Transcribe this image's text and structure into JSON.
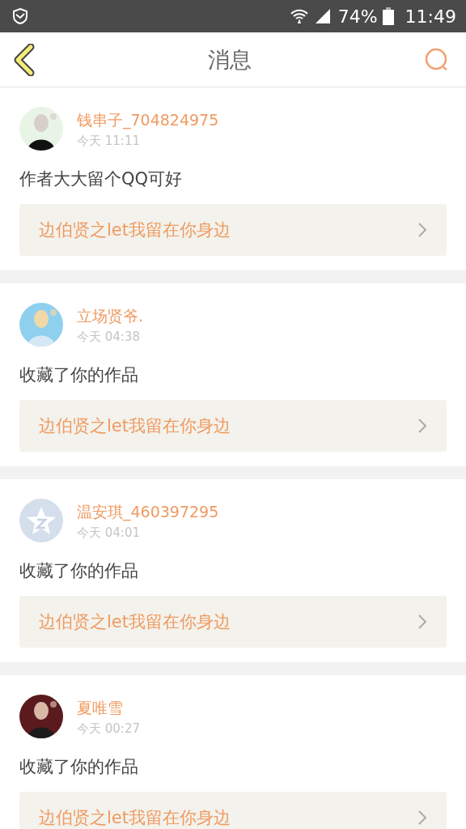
{
  "status_bar": {
    "battery": "74%",
    "time": "11:49"
  },
  "header": {
    "title": "消息"
  },
  "messages": [
    {
      "name": "钱串子_704824975",
      "time": "今天 11:11",
      "text": "作者大大留个QQ可好",
      "work": "边伯贤之let我留在你身边"
    },
    {
      "name": "立场贤爷.",
      "time": "今天 04:38",
      "text": "收藏了你的作品",
      "work": "边伯贤之let我留在你身边"
    },
    {
      "name": "温安琪_460397295",
      "time": "今天 04:01",
      "text": "收藏了你的作品",
      "work": "边伯贤之let我留在你身边",
      "avatar": {
        "kind": "default"
      }
    },
    {
      "name": "夏唯雪",
      "time": "今天 00:27",
      "text": "收藏了你的作品",
      "work": "边伯贤之let我留在你身边"
    }
  ]
}
